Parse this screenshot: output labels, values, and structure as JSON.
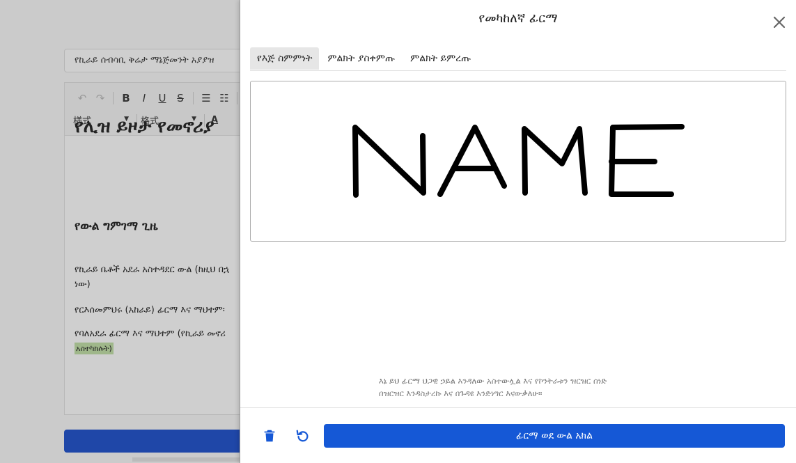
{
  "background": {
    "document_title": "የኪራይ ሰብሳቢ ቅሬታ ማኔጅመንት አያያዝ",
    "toolbar": {
      "undo": "↶",
      "redo": "↷",
      "bold": "B",
      "italic": "I",
      "underline": "U",
      "strike": "S",
      "styles_label": "様式",
      "format_label": "格式",
      "font_color": "A"
    },
    "heading": "የሊዝ ይዞታ የመኖሪያ",
    "subheading": "የውል ግምገማ ጊዜ",
    "paragraph1_line1": "የኪራይ ቤቶች አደራ አስተዳደር ውል (ከዚህ በኋ",
    "paragraph1_line2": "ነው)",
    "paragraph2": "የርእሰመምህሩ (አከራይ) ፊርማ እና ማህተም፡",
    "paragraph3_line1": "የባለአደራ ፊርማ እና ማህተም (የኪራይ መኖሪ",
    "paragraph3_highlight": "አስተካክሉት)"
  },
  "modal": {
    "title": "የመካከለኛ ፊርማ",
    "tabs": [
      {
        "label": "የእጅ ስምምነት",
        "active": true
      },
      {
        "label": "ምልክት ያስቀምጡ",
        "active": false
      },
      {
        "label": "ምልክት ይምረጡ",
        "active": false
      }
    ],
    "signature_text": "NAME",
    "legal_line1": "እኔ ይህ ፊርማ ህጋዊ ኃይል እንዳለው አስተውሏል እና የኮንትራቱን ዝርዝር ሰነድ",
    "legal_line2": "በዝርዝር እንዳስታረኩ እና በጉዳዩ እንድነግር እናውቃለሁ።",
    "primary_button": "ፊርማ ወደ ውል አክል",
    "colors": {
      "primary": "#1558d6",
      "active_tab_bg": "#e6e6e6",
      "icon_blue": "#1558d6"
    }
  }
}
